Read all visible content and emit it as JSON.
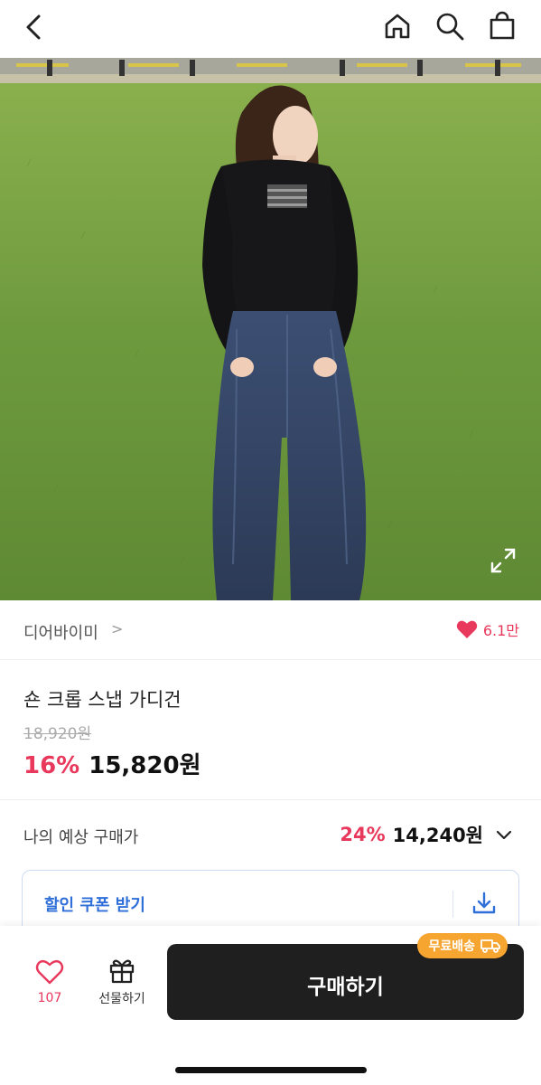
{
  "header": {
    "back_icon": "chevron-left-icon",
    "icons": [
      "home-icon",
      "search-icon",
      "shopping-bag-icon"
    ]
  },
  "product_image": {
    "icon": "expand-icon"
  },
  "brand": {
    "name": "디어바이미",
    "chevron": ">",
    "likes": "6.1만"
  },
  "product": {
    "title": "숀 크롭 스냅 가디건",
    "original_price": "18,920원",
    "discount": "16%",
    "price": "15,820원"
  },
  "expected_price": {
    "label": "나의 예상 구매가",
    "discount": "24%",
    "price": "14,240원"
  },
  "coupon": {
    "label": "할인 쿠폰 받기",
    "icon": "download-icon"
  },
  "bottom_bar": {
    "wish_count": "107",
    "gift_label": "선물하기",
    "buy_label": "구매하기",
    "shipping_badge": "무료배송"
  },
  "colors": {
    "accent_red": "#e8385c",
    "coupon_blue": "#2f6fd9",
    "badge_orange": "#f6a531",
    "buy_button": "#1f1f1f"
  }
}
